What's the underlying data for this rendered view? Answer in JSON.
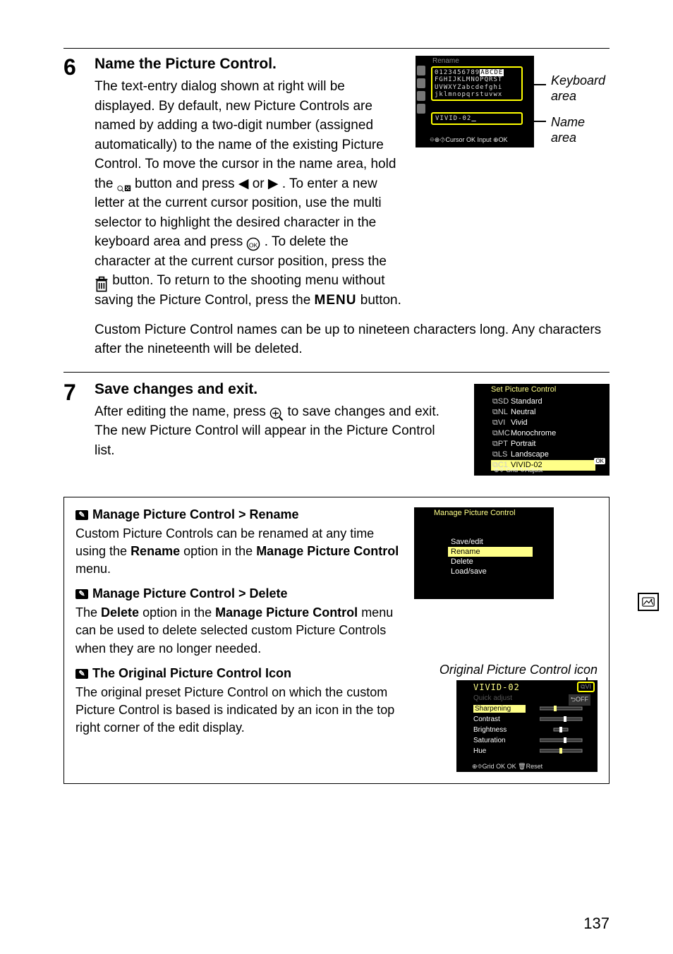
{
  "step6": {
    "num": "6",
    "heading": "Name the Picture Control.",
    "para1_a": "The text-entry dialog shown at right will be displayed.  By default, new Picture Controls are named by adding a two-digit number (assigned automatically) to the name of the existing Picture Control.  To move the cursor in the name area, hold the ",
    "para1_b": " button and press ",
    "para1_c": " or ",
    "para1_d": ".  To enter a new letter at the current cursor position, use the multi selector to highlight the desired character in the keyboard area and press ",
    "para1_e": ".  To delete the character at the current cursor position, press the ",
    "para1_f": " button.  To return to the shooting menu without saving the Picture Control, press the ",
    "para1_g": " button.",
    "menu_label": "MENU",
    "para2": "Custom Picture Control names can be up to nineteen characters long.  Any characters after the nineteenth will be deleted."
  },
  "rename_screen": {
    "title": "Rename",
    "kbd_rows": [
      "0123456789",
      "ABCDE",
      "FGHIJKLMNOPQRST",
      "UVWXYZabcdefghi",
      "jklmnopqrstuvwx"
    ],
    "name": "VIVID-02",
    "footer": "⯐⊕⯑Cursor   OK Input   ⊕OK",
    "annot_keyboard": "Keyboard area",
    "annot_name": "Name area"
  },
  "step7": {
    "num": "7",
    "heading": "Save changes and exit.",
    "para_a": "After editing the name, press ",
    "para_b": " to save changes and exit.  The new Picture Control will appear in the Picture Control list."
  },
  "setpc_screen": {
    "title": "Set Picture Control",
    "items": [
      {
        "ico": "⧉SD",
        "label": "Standard"
      },
      {
        "ico": "⧉NL",
        "label": "Neutral"
      },
      {
        "ico": "⧉VI",
        "label": "Vivid"
      },
      {
        "ico": "⧉MC",
        "label": "Monochrome"
      },
      {
        "ico": "⧉PT",
        "label": "Portrait"
      },
      {
        "ico": "⧉LS",
        "label": "Landscape"
      },
      {
        "ico": "⧉C1",
        "label": "VIVID-02"
      }
    ],
    "ok": "OK",
    "footer": "⊕⯑ Grid         ↻Adjust"
  },
  "notes": {
    "rename_h": "Manage Picture Control > Rename",
    "rename_p_a": "Custom Picture Controls can be renamed at any time using the ",
    "rename_p_b": "Rename",
    "rename_p_c": " option in the ",
    "rename_p_d": "Manage Picture Control",
    "rename_p_e": " menu.",
    "delete_h": "Manage Picture Control > Delete",
    "delete_p_a": "The ",
    "delete_p_b": "Delete",
    "delete_p_c": " option in the ",
    "delete_p_d": "Manage Picture Control",
    "delete_p_e": " menu can be used to delete selected custom Picture Controls when they are no longer needed.",
    "orig_h": "The Original Picture Control Icon",
    "orig_p": "The original preset Picture Control on which the custom Picture Control is based is indicated by an icon in the top right corner of the edit display."
  },
  "mpc_screen": {
    "title": "Manage Picture Control",
    "opts": [
      "Save/edit",
      "Rename",
      "Delete",
      "Load/save"
    ]
  },
  "orig_caption": "Original Picture Control icon",
  "edit_screen": {
    "title": "VIVID-02",
    "badge": "⧉VI",
    "off": "⮌OFF",
    "rows": [
      "Quick adjust",
      "Sharpening",
      "Contrast",
      "Brightness",
      "Saturation",
      "Hue"
    ],
    "footer": "⊕⯑Grid    OK OK    🗑Reset"
  },
  "page_number": "137"
}
